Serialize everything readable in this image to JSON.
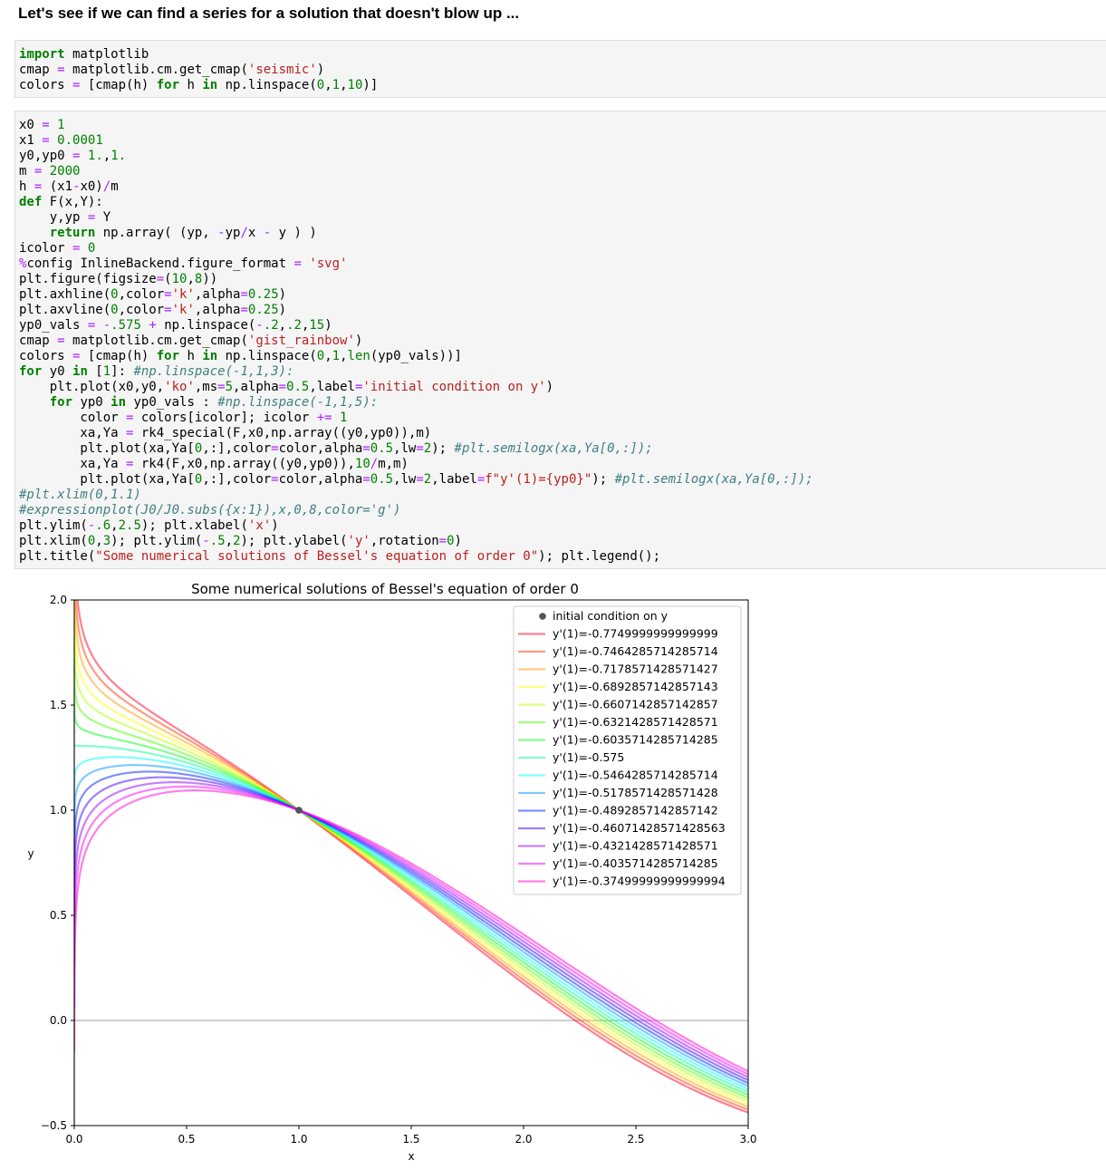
{
  "heading": "Let's see if we can find a series for a solution that doesn't blow up ...",
  "cells": [
    {
      "lines": [
        [
          [
            "kw",
            "import"
          ],
          [
            "t",
            " matplotlib"
          ]
        ],
        [
          [
            "t",
            "cmap "
          ],
          [
            "op",
            "="
          ],
          [
            "t",
            " matplotlib.cm.get_cmap("
          ],
          [
            "str",
            "'seismic'"
          ],
          [
            "t",
            ")"
          ]
        ],
        [
          [
            "t",
            "colors "
          ],
          [
            "op",
            "="
          ],
          [
            "t",
            " [cmap(h) "
          ],
          [
            "kw",
            "for"
          ],
          [
            "t",
            " h "
          ],
          [
            "kw",
            "in"
          ],
          [
            "t",
            " np.linspace("
          ],
          [
            "num",
            "0"
          ],
          [
            "t",
            ","
          ],
          [
            "num",
            "1"
          ],
          [
            "t",
            ","
          ],
          [
            "num",
            "10"
          ],
          [
            "t",
            ")]"
          ]
        ]
      ]
    },
    {
      "lines": [
        [
          [
            "t",
            "x0 "
          ],
          [
            "op",
            "="
          ],
          [
            "t",
            " "
          ],
          [
            "num",
            "1"
          ]
        ],
        [
          [
            "t",
            "x1 "
          ],
          [
            "op",
            "="
          ],
          [
            "t",
            " "
          ],
          [
            "num",
            "0.0001"
          ]
        ],
        [
          [
            "t",
            "y0,yp0 "
          ],
          [
            "op",
            "="
          ],
          [
            "t",
            " "
          ],
          [
            "num",
            "1."
          ],
          [
            "t",
            ","
          ],
          [
            "num",
            "1."
          ]
        ],
        [
          [
            "t",
            "m "
          ],
          [
            "op",
            "="
          ],
          [
            "t",
            " "
          ],
          [
            "num",
            "2000"
          ]
        ],
        [
          [
            "t",
            "h "
          ],
          [
            "op",
            "="
          ],
          [
            "t",
            " (x1"
          ],
          [
            "op",
            "-"
          ],
          [
            "t",
            "x0)"
          ],
          [
            "op",
            "/"
          ],
          [
            "t",
            "m"
          ]
        ],
        [
          [
            "kw",
            "def"
          ],
          [
            "t",
            " F(x,Y):"
          ]
        ],
        [
          [
            "t",
            "    y,yp "
          ],
          [
            "op",
            "="
          ],
          [
            "t",
            " Y"
          ]
        ],
        [
          [
            "t",
            "    "
          ],
          [
            "kw",
            "return"
          ],
          [
            "t",
            " np.array( (yp, "
          ],
          [
            "op",
            "-"
          ],
          [
            "t",
            "yp"
          ],
          [
            "op",
            "/"
          ],
          [
            "t",
            "x "
          ],
          [
            "op",
            "-"
          ],
          [
            "t",
            " y ) )"
          ]
        ],
        [
          [
            "t",
            "icolor "
          ],
          [
            "op",
            "="
          ],
          [
            "t",
            " "
          ],
          [
            "num",
            "0"
          ]
        ],
        [
          [
            "op",
            "%"
          ],
          [
            "t",
            "config InlineBackend.figure_format "
          ],
          [
            "op",
            "="
          ],
          [
            "t",
            " "
          ],
          [
            "str",
            "'svg'"
          ]
        ],
        [
          [
            "t",
            "plt.figure(figsize"
          ],
          [
            "op",
            "="
          ],
          [
            "t",
            "("
          ],
          [
            "num",
            "10"
          ],
          [
            "t",
            ","
          ],
          [
            "num",
            "8"
          ],
          [
            "t",
            "))"
          ]
        ],
        [
          [
            "t",
            "plt.axhline("
          ],
          [
            "num",
            "0"
          ],
          [
            "t",
            ",color"
          ],
          [
            "op",
            "="
          ],
          [
            "str",
            "'k'"
          ],
          [
            "t",
            ",alpha"
          ],
          [
            "op",
            "="
          ],
          [
            "num",
            "0.25"
          ],
          [
            "t",
            ")"
          ]
        ],
        [
          [
            "t",
            "plt.axvline("
          ],
          [
            "num",
            "0"
          ],
          [
            "t",
            ",color"
          ],
          [
            "op",
            "="
          ],
          [
            "str",
            "'k'"
          ],
          [
            "t",
            ",alpha"
          ],
          [
            "op",
            "="
          ],
          [
            "num",
            "0.25"
          ],
          [
            "t",
            ")"
          ]
        ],
        [
          [
            "t",
            "yp0_vals "
          ],
          [
            "op",
            "="
          ],
          [
            "t",
            " "
          ],
          [
            "op",
            "-"
          ],
          [
            "num",
            ".575"
          ],
          [
            "t",
            " "
          ],
          [
            "op",
            "+"
          ],
          [
            "t",
            " np.linspace("
          ],
          [
            "op",
            "-"
          ],
          [
            "num",
            ".2"
          ],
          [
            "t",
            ","
          ],
          [
            "num",
            ".2"
          ],
          [
            "t",
            ","
          ],
          [
            "num",
            "15"
          ],
          [
            "t",
            ")"
          ]
        ],
        [
          [
            "t",
            "cmap "
          ],
          [
            "op",
            "="
          ],
          [
            "t",
            " matplotlib.cm.get_cmap("
          ],
          [
            "str",
            "'gist_rainbow'"
          ],
          [
            "t",
            ")"
          ]
        ],
        [
          [
            "t",
            "colors "
          ],
          [
            "op",
            "="
          ],
          [
            "t",
            " [cmap(h) "
          ],
          [
            "kw",
            "for"
          ],
          [
            "t",
            " h "
          ],
          [
            "kw",
            "in"
          ],
          [
            "t",
            " np.linspace("
          ],
          [
            "num",
            "0"
          ],
          [
            "t",
            ","
          ],
          [
            "num",
            "1"
          ],
          [
            "t",
            ","
          ],
          [
            "bi",
            "len"
          ],
          [
            "t",
            "(yp0_vals))]"
          ]
        ],
        [
          [
            "kw",
            "for"
          ],
          [
            "t",
            " y0 "
          ],
          [
            "kw",
            "in"
          ],
          [
            "t",
            " ["
          ],
          [
            "num",
            "1"
          ],
          [
            "t",
            "]: "
          ],
          [
            "cm",
            "#np.linspace(-1,1,3):"
          ]
        ],
        [
          [
            "t",
            "    plt.plot(x0,y0,"
          ],
          [
            "str",
            "'ko'"
          ],
          [
            "t",
            ",ms"
          ],
          [
            "op",
            "="
          ],
          [
            "num",
            "5"
          ],
          [
            "t",
            ",alpha"
          ],
          [
            "op",
            "="
          ],
          [
            "num",
            "0.5"
          ],
          [
            "t",
            ",label"
          ],
          [
            "op",
            "="
          ],
          [
            "str",
            "'initial condition on y'"
          ],
          [
            "t",
            ")"
          ]
        ],
        [
          [
            "t",
            "    "
          ],
          [
            "kw",
            "for"
          ],
          [
            "t",
            " yp0 "
          ],
          [
            "kw",
            "in"
          ],
          [
            "t",
            " yp0_vals : "
          ],
          [
            "cm",
            "#np.linspace(-1,1,5):"
          ]
        ],
        [
          [
            "t",
            "        color "
          ],
          [
            "op",
            "="
          ],
          [
            "t",
            " colors[icolor]; icolor "
          ],
          [
            "op",
            "+="
          ],
          [
            "t",
            " "
          ],
          [
            "num",
            "1"
          ]
        ],
        [
          [
            "t",
            "        xa,Ya "
          ],
          [
            "op",
            "="
          ],
          [
            "t",
            " rk4_special(F,x0,np.array((y0,yp0)),m)"
          ]
        ],
        [
          [
            "t",
            "        plt.plot(xa,Ya["
          ],
          [
            "num",
            "0"
          ],
          [
            "t",
            ",:],color"
          ],
          [
            "op",
            "="
          ],
          [
            "t",
            "color,alpha"
          ],
          [
            "op",
            "="
          ],
          [
            "num",
            "0.5"
          ],
          [
            "t",
            ",lw"
          ],
          [
            "op",
            "="
          ],
          [
            "num",
            "2"
          ],
          [
            "t",
            "); "
          ],
          [
            "cm",
            "#plt.semilogx(xa,Ya[0,:]);"
          ]
        ],
        [
          [
            "t",
            "        xa,Ya "
          ],
          [
            "op",
            "="
          ],
          [
            "t",
            " rk4(F,x0,np.array((y0,yp0)),"
          ],
          [
            "num",
            "10"
          ],
          [
            "op",
            "/"
          ],
          [
            "t",
            "m,m)"
          ]
        ],
        [
          [
            "t",
            "        plt.plot(xa,Ya["
          ],
          [
            "num",
            "0"
          ],
          [
            "t",
            ",:],color"
          ],
          [
            "op",
            "="
          ],
          [
            "t",
            "color,alpha"
          ],
          [
            "op",
            "="
          ],
          [
            "num",
            "0.5"
          ],
          [
            "t",
            ",lw"
          ],
          [
            "op",
            "="
          ],
          [
            "num",
            "2"
          ],
          [
            "t",
            ",label"
          ],
          [
            "op",
            "="
          ],
          [
            "str",
            "f\"y'(1)={yp0}\""
          ],
          [
            "t",
            "); "
          ],
          [
            "cm",
            "#plt.semilogx(xa,Ya[0,:]);"
          ]
        ],
        [
          [
            "cm",
            "#plt.xlim(0,1.1)"
          ]
        ],
        [
          [
            "cm",
            "#expressionplot(J0/J0.subs({x:1}),x,0,8,color='g')"
          ]
        ],
        [
          [
            "t",
            "plt.ylim("
          ],
          [
            "op",
            "-"
          ],
          [
            "num",
            ".6"
          ],
          [
            "t",
            ","
          ],
          [
            "num",
            "2.5"
          ],
          [
            "t",
            "); plt.xlabel("
          ],
          [
            "str",
            "'x'"
          ],
          [
            "t",
            ")"
          ]
        ],
        [
          [
            "t",
            "plt.xlim("
          ],
          [
            "num",
            "0"
          ],
          [
            "t",
            ","
          ],
          [
            "num",
            "3"
          ],
          [
            "t",
            "); plt.ylim("
          ],
          [
            "op",
            "-"
          ],
          [
            "num",
            ".5"
          ],
          [
            "t",
            ","
          ],
          [
            "num",
            "2"
          ],
          [
            "t",
            "); plt.ylabel("
          ],
          [
            "str",
            "'y'"
          ],
          [
            "t",
            ",rotation"
          ],
          [
            "op",
            "="
          ],
          [
            "num",
            "0"
          ],
          [
            "t",
            ")"
          ]
        ],
        [
          [
            "t",
            "plt.title("
          ],
          [
            "str",
            "\"Some numerical solutions of Bessel's equation of order 0\""
          ],
          [
            "t",
            "); plt.legend();"
          ]
        ]
      ]
    }
  ],
  "chart_data": {
    "type": "line",
    "title": "Some numerical solutions of Bessel's equation of order 0",
    "xlabel": "x",
    "ylabel": "y",
    "xlim": [
      0,
      3
    ],
    "ylim": [
      -0.5,
      2
    ],
    "xticks": [
      "0.0",
      "0.5",
      "1.0",
      "1.5",
      "2.0",
      "2.5",
      "3.0"
    ],
    "yticks": [
      "−0.5",
      "0.0",
      "0.5",
      "1.0",
      "1.5",
      "2.0"
    ],
    "xtick_values": [
      0,
      0.5,
      1,
      1.5,
      2,
      2.5,
      3
    ],
    "ytick_values": [
      -0.5,
      0,
      0.5,
      1,
      1.5,
      2
    ],
    "hline": 0,
    "vline": 0,
    "legend_position": "top-right",
    "point": {
      "x": 1,
      "y": 1,
      "label": "initial condition on y",
      "color": "#555555"
    },
    "series": [
      {
        "name": "y'(1)=-0.7749999999999999",
        "color": "#ff0029"
      },
      {
        "name": "y'(1)=-0.7464285714285714",
        "color": "#ff3a00"
      },
      {
        "name": "y'(1)=-0.7178571428571427",
        "color": "#ff9e00"
      },
      {
        "name": "y'(1)=-0.6892857142857143",
        "color": "#fbff00"
      },
      {
        "name": "y'(1)=-0.6607142857142857",
        "color": "#b3ff00"
      },
      {
        "name": "y'(1)=-0.6321428571428571",
        "color": "#4aff00"
      },
      {
        "name": "y'(1)=-0.6035714285714285",
        "color": "#00ff1c"
      },
      {
        "name": "y'(1)=-0.575",
        "color": "#00ff97"
      },
      {
        "name": "y'(1)=-0.5464285714285714",
        "color": "#00fbff"
      },
      {
        "name": "y'(1)=-0.5178571428571428",
        "color": "#0097ff"
      },
      {
        "name": "y'(1)=-0.4892857142857142",
        "color": "#0022ff"
      },
      {
        "name": "y'(1)=-0.46071428571428563",
        "color": "#3900ff"
      },
      {
        "name": "y'(1)=-0.4321428571428571",
        "color": "#8f00ff"
      },
      {
        "name": "y'(1)=-0.4035714285714285",
        "color": "#f300ff"
      },
      {
        "name": "y'(1)=-0.37499999999999994",
        "color": "#ff00ce"
      }
    ]
  }
}
